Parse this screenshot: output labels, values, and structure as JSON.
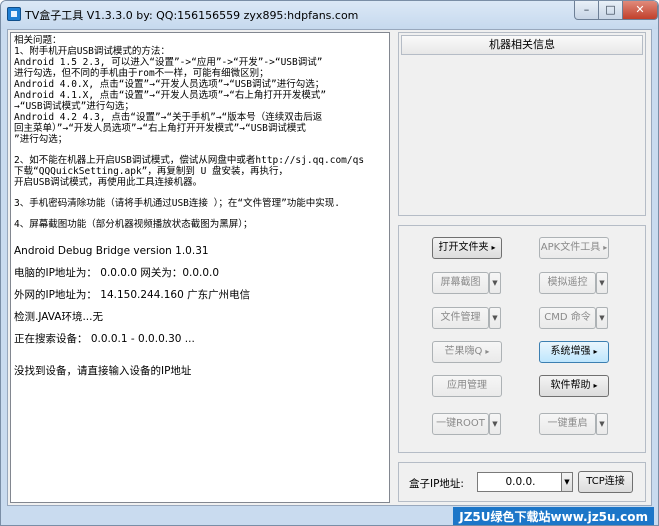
{
  "window": {
    "title": "TV盒子工具 V1.3.3.0 by: QQ:156156559  zyx895:hdpfans.com",
    "minimize": "–",
    "maximize": "□",
    "close": "✕"
  },
  "log": {
    "lines": [
      "相关问题：",
      "1、附手机开启USB调试模式的方法：",
      "Android 1.5 2.3, 可以进入“设置”->“应用”->“开发”->“USB调试”",
      "进行勾选，但不同的手机由于rom不一样，可能有细微区别；",
      "Android 4.0.X, 点击“设置”→“开发人员选项”→“USB调试”进行勾选；",
      "Android 4.1.X, 点击“设置”→“开发人员选项”→“右上角打开开发模式”",
      "→“USB调试模式”进行勾选；",
      "Android 4.2 4.3, 点击“设置”→“关于手机”→“版本号（连续双击后返",
      "回主菜单）”→“开发人员选项”→“右上角打开开发模式”→“USB调试模式",
      "”进行勾选；",
      "",
      "2、如不能在机器上开启USB调试模式，偿试从网盘中或者http://sj.qq.com/qs",
      "下载“QQQuickSetting.apk”，再复制到 U 盘安装，再执行，",
      "开启USB调试模式，再使用此工具连接机器。",
      "",
      "3、手机密码清除功能（请将手机通过USB连接 ）；在“文件管理”功能中实现.",
      "",
      "4、屏幕截图功能（部分机器视频播放状态截图为黑屏）；",
      ""
    ],
    "adb_version": "Android Debug Bridge version 1.0.31",
    "status": [
      "电脑的IP地址为： 0.0.0.0 网关为：0.0.0.0",
      "外网的IP地址为： 14.150.244.160 广东广州电信",
      "检测.JAVA环境...无",
      "正在搜索设备： 0.0.0.1 - 0.0.0.30 ...",
      "",
      "没找到设备，请直接输入设备的IP地址"
    ]
  },
  "machine_info": {
    "title": "机器相关信息"
  },
  "buttons": {
    "open_folder": "打开文件夹",
    "apk_file_tools": "APK文件工具",
    "screenshot": "屏幕截图",
    "remote_control": "模拟遥控",
    "file_manager": "文件管理",
    "cmd_command": "CMD 命令",
    "mango_tv": "芒果嗨Q",
    "system_enhance": "系统增强",
    "app_manager": "应用管理",
    "software_help": "软件帮助",
    "one_click_root": "一键ROOT",
    "one_click_reboot": "一键重启",
    "tcp_connect": "TCP连接"
  },
  "address": {
    "label": "盒子IP地址:",
    "value": "0.0.0."
  },
  "watermark": "JZ5U绿色下载站www.jz5u.com",
  "icons": {
    "dropdown": "▼",
    "menu_arrow": "▸"
  }
}
